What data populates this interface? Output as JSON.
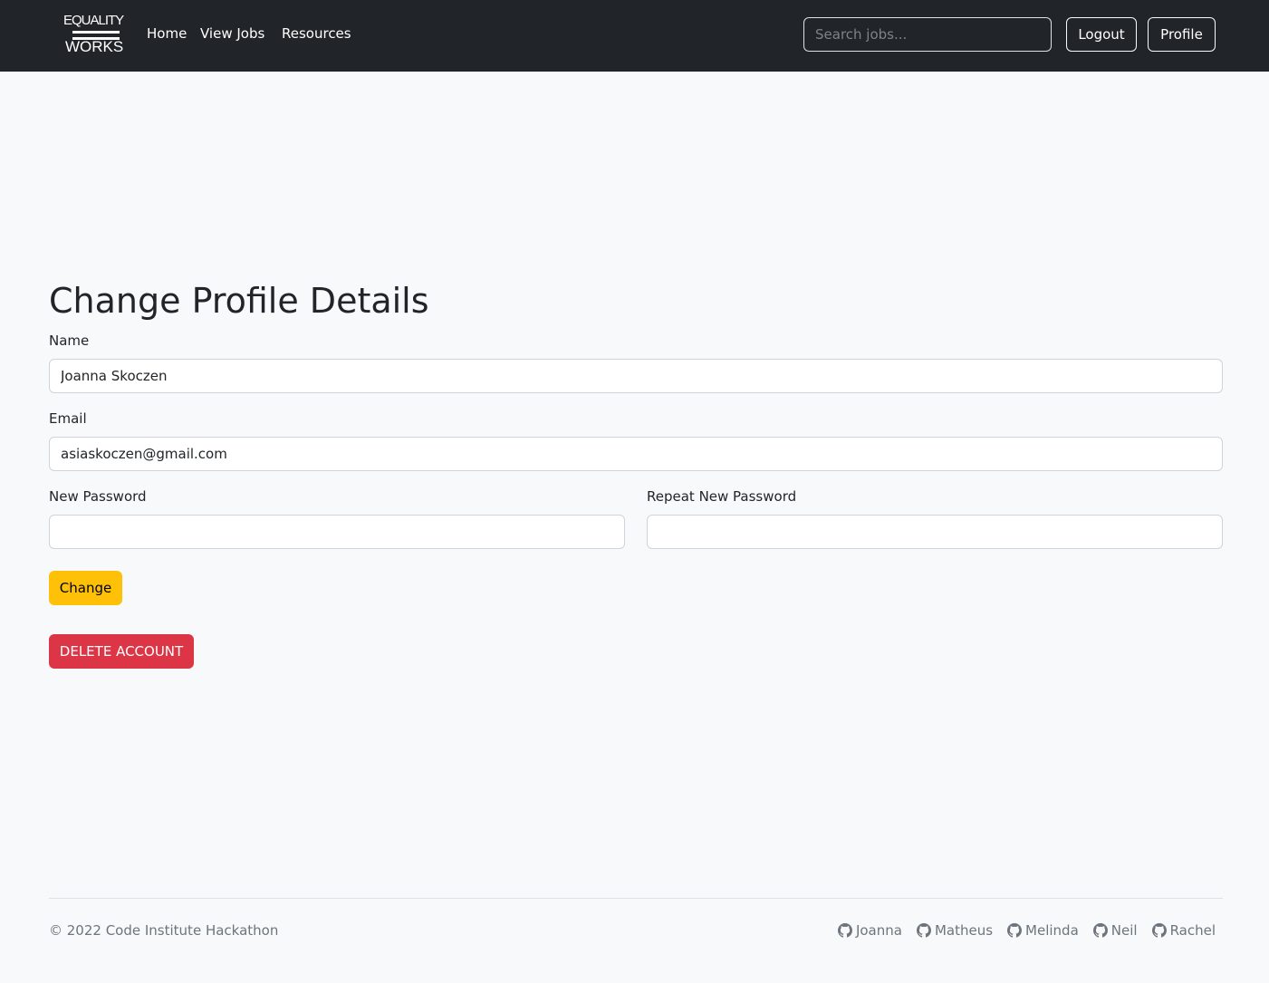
{
  "navbar": {
    "brand_line1": "EQUALITY",
    "brand_line2": "WORKS",
    "links": [
      "Home",
      "View Jobs",
      "Resources"
    ],
    "search_placeholder": "Search jobs...",
    "logout_label": "Logout",
    "profile_label": "Profile"
  },
  "main": {
    "title": "Change Profile Details",
    "name_label": "Name",
    "name_value": "Joanna Skoczen",
    "email_label": "Email",
    "email_value": "asiaskoczen@gmail.com",
    "new_password_label": "New Password",
    "repeat_password_label": "Repeat New Password",
    "change_label": "Change",
    "delete_label": "DELETE ACCOUNT"
  },
  "footer": {
    "copyright": "© 2022 Code Institute Hackathon",
    "contributors": [
      "Joanna",
      "Matheus",
      "Melinda",
      "Neil",
      "Rachel"
    ],
    "contributor_icon": "github-icon"
  },
  "colors": {
    "navbar_bg": "#212529",
    "page_bg": "#f8f9fa",
    "warning": "#ffc107",
    "danger": "#dc3545"
  }
}
